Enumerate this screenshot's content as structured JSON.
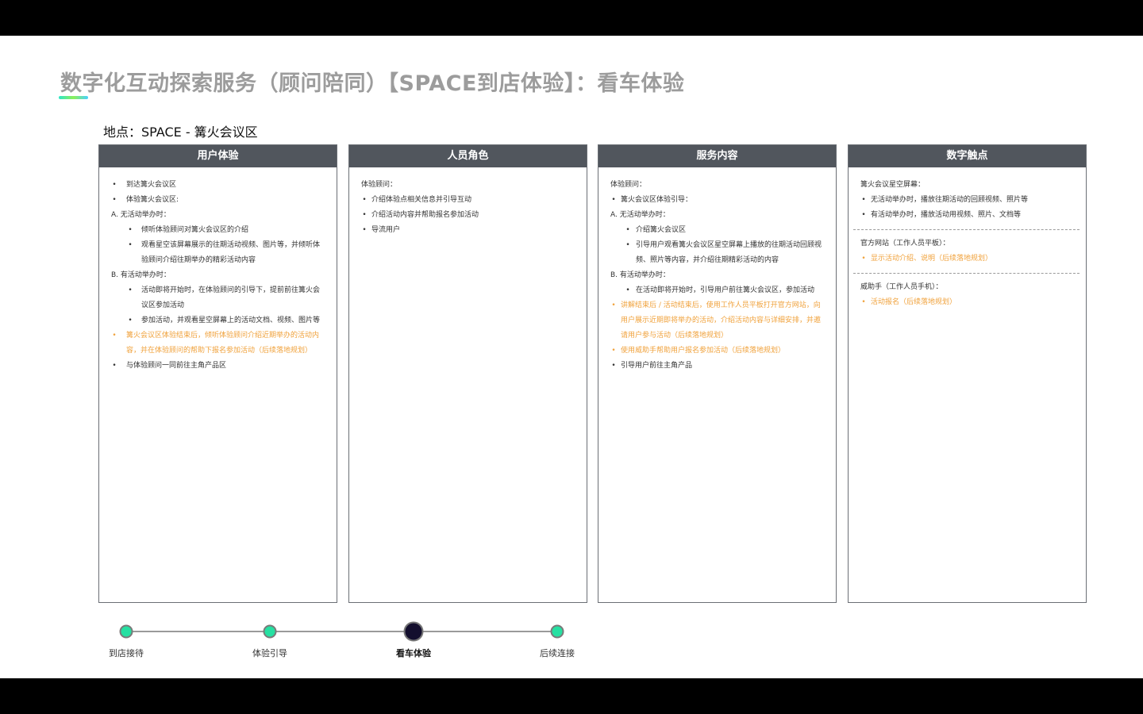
{
  "title": "数字化互动探索服务（顾问陪同）【SPACE到店体验】：看车体验",
  "location": "地点：SPACE - 篝火会议区",
  "colors": {
    "header_bg": "#51565d",
    "accent_orange": "#f0a23c",
    "timeline_done": "#26e0a2",
    "timeline_current": "#140f2e"
  },
  "columns": [
    {
      "header": "用户体验",
      "lines": [
        {
          "bullet": "•",
          "text": "到达篝火会议区"
        },
        {
          "bullet": "•",
          "text": "体验篝火会议区:"
        },
        {
          "bullet": "",
          "text": "A. 无活动举办时："
        },
        {
          "bullet": "•",
          "text": "倾听体验顾问对篝火会议区的介绍"
        },
        {
          "bullet": "•",
          "text": "观看星空该屏幕展示的往期活动视频、图片等，并倾听体"
        },
        {
          "bullet": "",
          "text": "验顾问介绍往期举办的精彩活动内容"
        },
        {
          "bullet": "",
          "text": "B. 有活动举办时："
        },
        {
          "bullet": "•",
          "text": "活动即将开始时，在体验顾问的引导下，提前前往篝火会"
        },
        {
          "bullet": "",
          "text": "议区参加活动"
        },
        {
          "bullet": "•",
          "text": "参加活动，并观看星空屏幕上的活动文档、视频、图片等"
        },
        {
          "bullet": "•",
          "text": "篝火会议区体验结束后，倾听体验顾问介绍近期举办的活动内"
        },
        {
          "bullet": "",
          "text": "容，并在体验顾问的帮助下报名参加活动（后续落地规划）"
        },
        {
          "bullet": "•",
          "text": "与体验顾问一同前往主角产品区"
        }
      ]
    },
    {
      "header": "人员角色",
      "lines": [
        {
          "bullet": "",
          "text": "体验顾问："
        },
        {
          "bullet": "•",
          "text": "介绍体验点相关信息并引导互动"
        },
        {
          "bullet": "•",
          "text": "介绍活动内容并帮助报名参加活动"
        },
        {
          "bullet": "•",
          "text": "导流用户"
        }
      ]
    },
    {
      "header": "服务内容",
      "lines": [
        {
          "bullet": "",
          "text": "体验顾问："
        },
        {
          "bullet": "•",
          "text": "篝火会议区体验引导："
        },
        {
          "bullet": "",
          "text": "A. 无活动举办时："
        },
        {
          "bullet": "•",
          "text": "介绍篝火会议区"
        },
        {
          "bullet": "•",
          "text": "引导用户观看篝火会议区星空屏幕上播放的往期活动回顾视"
        },
        {
          "bullet": "",
          "text": "频、照片等内容，并介绍往期精彩活动的内容"
        },
        {
          "bullet": "",
          "text": "B. 有活动举办时："
        },
        {
          "bullet": "•",
          "text": "在活动即将开始时，引导用户前往篝火会议区，参加活动"
        },
        {
          "bullet": "•",
          "text": "讲解结束后 / 活动结束后，使用工作人员平板打开官方网站，向"
        },
        {
          "bullet": "",
          "text": "用户展示近期即将举办的活动，介绍活动内容与详细安排，并邀"
        },
        {
          "bullet": "",
          "text": "请用户参与活动（后续落地规划）"
        },
        {
          "bullet": "•",
          "text": "使用威助手帮助用户报名参加活动（后续落地规划）"
        },
        {
          "bullet": "•",
          "text": "引导用户前往主角产品"
        }
      ]
    },
    {
      "header": "数字触点",
      "lines": [
        {
          "bullet": "",
          "text": "篝火会议星空屏幕："
        },
        {
          "bullet": "•",
          "text": "无活动举办时，播放往期活动的回顾视频、照片等"
        },
        {
          "bullet": "•",
          "text": "有活动举办时，播放活动用视频、照片、文档等"
        },
        {
          "bullet": "",
          "text": "官方网站（工作人员平板）："
        },
        {
          "bullet": "•",
          "text": "显示活动介绍、说明（后续落地规划）"
        },
        {
          "bullet": "",
          "text": "威助手（工作人员手机）："
        },
        {
          "bullet": "•",
          "text": "活动报名（后续落地规划）"
        }
      ]
    }
  ],
  "timeline": [
    {
      "label": "到店接待",
      "state": "done"
    },
    {
      "label": "体验引导",
      "state": "done"
    },
    {
      "label": "看车体验",
      "state": "current"
    },
    {
      "label": "后续连接",
      "state": "done"
    }
  ]
}
